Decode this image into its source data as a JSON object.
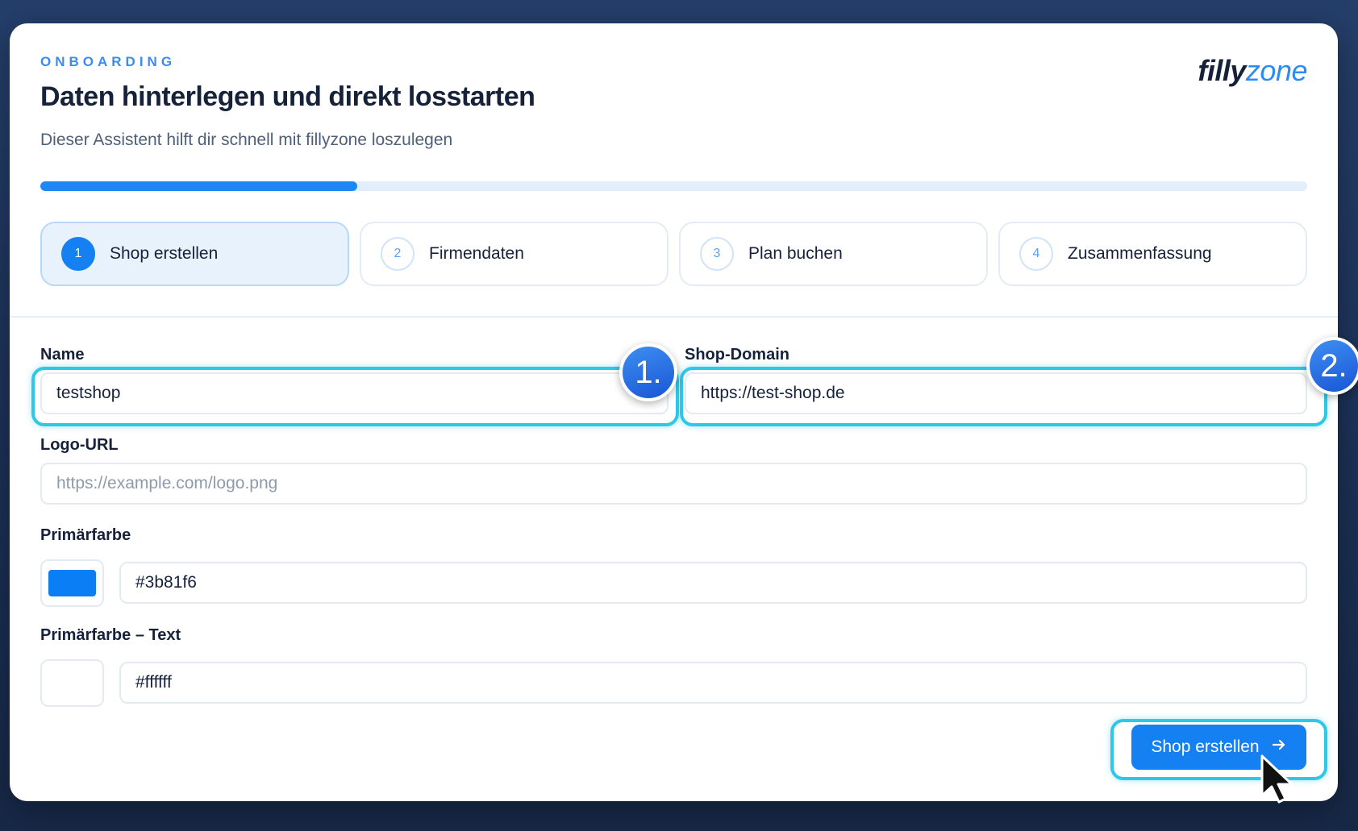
{
  "header": {
    "eyebrow": "ONBOARDING",
    "title": "Daten hinterlegen und direkt losstarten",
    "subtitle": "Dieser Assistent hilft dir schnell mit fillyzone loszulegen",
    "logo_part1": "filly",
    "logo_part2": "zone"
  },
  "progress": {
    "value_percent": 25,
    "color": "#1f86f2"
  },
  "steps": [
    {
      "num": "1",
      "label": "Shop erstellen",
      "active": true
    },
    {
      "num": "2",
      "label": "Firmendaten",
      "active": false
    },
    {
      "num": "3",
      "label": "Plan buchen",
      "active": false
    },
    {
      "num": "4",
      "label": "Zusammenfassung",
      "active": false
    }
  ],
  "form": {
    "name_label": "Name",
    "name_value": "testshop",
    "domain_label": "Shop-Domain",
    "domain_value": "https://test-shop.de",
    "logo_label": "Logo-URL",
    "logo_placeholder": "https://example.com/logo.png",
    "primary_label": "Primärfarbe",
    "primary_value": "#3b81f6",
    "primary_swatch": "#0a7ff5",
    "primary_text_label": "Primärfarbe – Text",
    "primary_text_value": "#ffffff",
    "primary_text_swatch": "#ffffff"
  },
  "annotations": {
    "badge1": "1.",
    "badge2": "2.",
    "highlight_color": "#2ec7e8"
  },
  "actions": {
    "submit_label": "Shop erstellen",
    "submit_icon": "arrow-right-icon"
  }
}
